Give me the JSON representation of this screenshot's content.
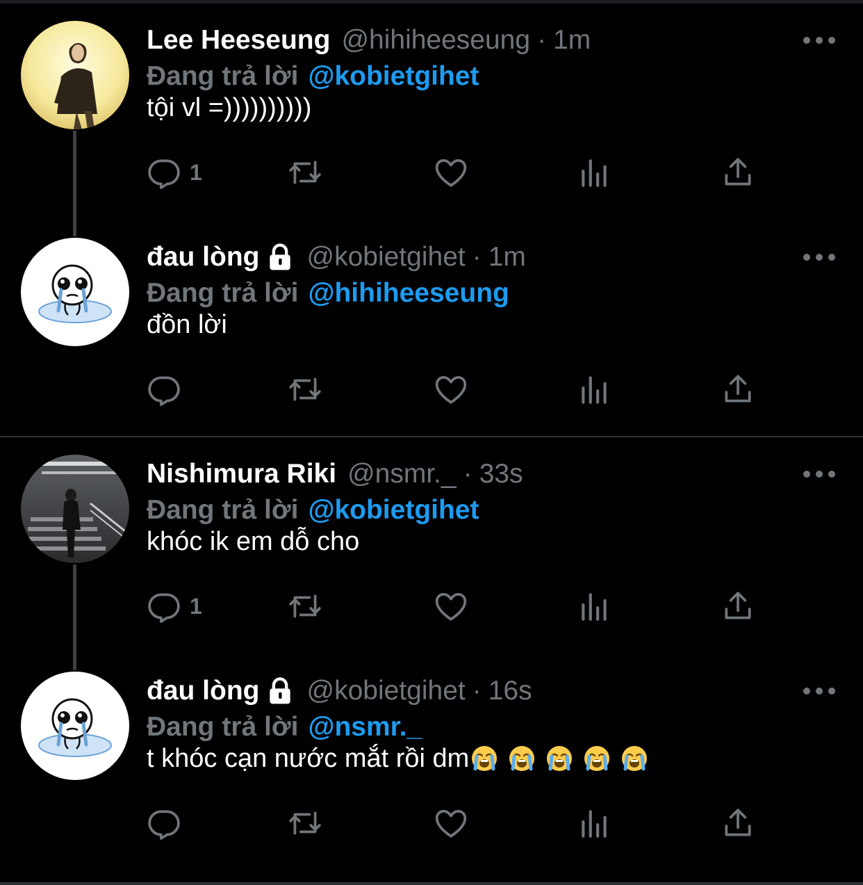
{
  "tweets": [
    {
      "name": "Lee Heeseung",
      "handle": "@hihiheeseung",
      "separator": "·",
      "time": "1m",
      "reply_label": "Đang trả lời",
      "reply_to": "@kobietgihet",
      "text": "tội vl =))))))))))",
      "reply_count": "1",
      "locked": false,
      "avatar": "avatar-photo-man-warm-bg"
    },
    {
      "name": "đau lòng",
      "handle": "@kobietgihet",
      "separator": "·",
      "time": "1m",
      "reply_label": "Đang trả lời",
      "reply_to": "@hihiheeseung",
      "text": "đồn lời",
      "reply_count": "",
      "locked": true,
      "avatar": "avatar-crying-doodle"
    },
    {
      "name": "Nishimura Riki",
      "handle": "@nsmr._",
      "separator": "·",
      "time": "33s",
      "reply_label": "Đang trả lời",
      "reply_to": "@kobietgihet",
      "text": "khóc ik em dỗ cho",
      "reply_count": "1",
      "locked": false,
      "avatar": "avatar-photo-stairs"
    },
    {
      "name": "đau lòng",
      "handle": "@kobietgihet",
      "separator": "·",
      "time": "16s",
      "reply_label": "Đang trả lời",
      "reply_to": "@nsmr._",
      "text": "t khóc cạn nước mắt rồi dm",
      "emoji_trail": [
        "loudly-crying-face",
        "loudly-crying-face",
        "loudly-crying-face",
        "loudly-crying-face",
        "loudly-crying-face"
      ],
      "reply_count": "",
      "locked": true,
      "avatar": "avatar-crying-doodle"
    }
  ],
  "icons": {
    "reply": "reply-icon",
    "retweet": "retweet-icon",
    "like": "heart-icon",
    "views": "views-icon",
    "share": "share-icon",
    "more": "more-icon",
    "lock": "lock-icon"
  },
  "colors": {
    "background": "#000000",
    "name": "#ffffff",
    "muted": "#71767b",
    "mention": "#1d9bf0",
    "thread_line": "#3c4043"
  }
}
